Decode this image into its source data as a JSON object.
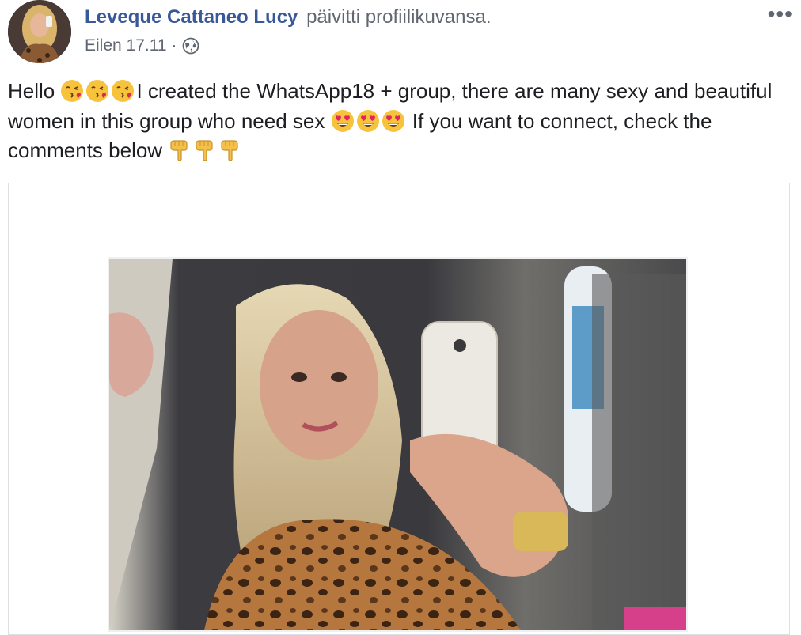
{
  "post": {
    "author": "Leveque Cattaneo Lucy",
    "action": "päivitti profiilikuvansa.",
    "timestamp": "Eilen 17.11",
    "separator": "·",
    "audience_icon": "globe-icon",
    "more_label": "•••",
    "text_segments": {
      "hello": "Hello ",
      "part1": "I created the WhatsApp18 + group, there are many sexy and beautiful women in this group who need sex ",
      "part2": " If you want to connect, check the comments below "
    },
    "emojis": {
      "kiss": "kissing-face-with-heart-emoji",
      "hearts": "heart-eyes-emoji",
      "point_down": "backhand-index-pointing-down-emoji"
    }
  },
  "colors": {
    "author": "#385898",
    "secondary": "#606770",
    "text": "#1c1e21",
    "border": "#dddfe2"
  }
}
